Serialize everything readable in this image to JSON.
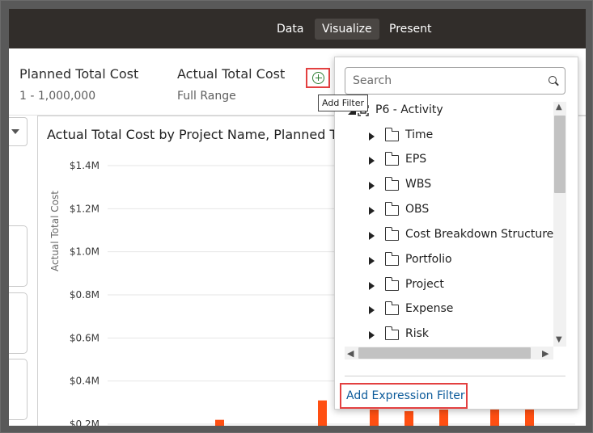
{
  "topbar": {
    "tabs": [
      {
        "label": "Data",
        "active": false
      },
      {
        "label": "Visualize",
        "active": true
      },
      {
        "label": "Present",
        "active": false
      }
    ]
  },
  "filters": [
    {
      "title": "Planned Total Cost",
      "value": "1 - 1,000,000"
    },
    {
      "title": "Actual Total Cost",
      "value": "Full Range"
    }
  ],
  "add_filter": {
    "icon": "plus-circle-icon",
    "tooltip": "Add Filter"
  },
  "chart": {
    "title": "Actual Total Cost by Project Name, Planned To",
    "ylabel": "Actual Total Cost"
  },
  "chart_data": {
    "type": "bar",
    "title": "Actual Total Cost by Project Name, Planned To",
    "ylabel": "Actual Total Cost",
    "y_ticks": [
      "$1.4M",
      "$1.2M",
      "$1.0M",
      "$0.8M",
      "$0.6M",
      "$0.4M",
      "$0.2M"
    ],
    "ylim": [
      0.2,
      1.4
    ],
    "bar_color": "#ff4f12",
    "bars_visible": [
      {
        "value": 0.22
      },
      {
        "value": 0.31
      },
      {
        "value": 0.29
      },
      {
        "value": 0.26
      },
      {
        "value": 0.29
      },
      {
        "value": 0.29
      },
      {
        "value": 0.29
      }
    ]
  },
  "popup": {
    "search_placeholder": "Search",
    "tree": {
      "root": "P6 - Activity",
      "items": [
        "Time",
        "EPS",
        "WBS",
        "OBS",
        "Cost Breakdown Structure",
        "Portfolio",
        "Project",
        "Expense",
        "Risk"
      ]
    },
    "add_expression_label": "Add Expression Filter"
  },
  "colors": {
    "topbar": "#312d2a",
    "highlight": "#e34040",
    "link": "#0b5a9a",
    "bar": "#ff4f12"
  }
}
